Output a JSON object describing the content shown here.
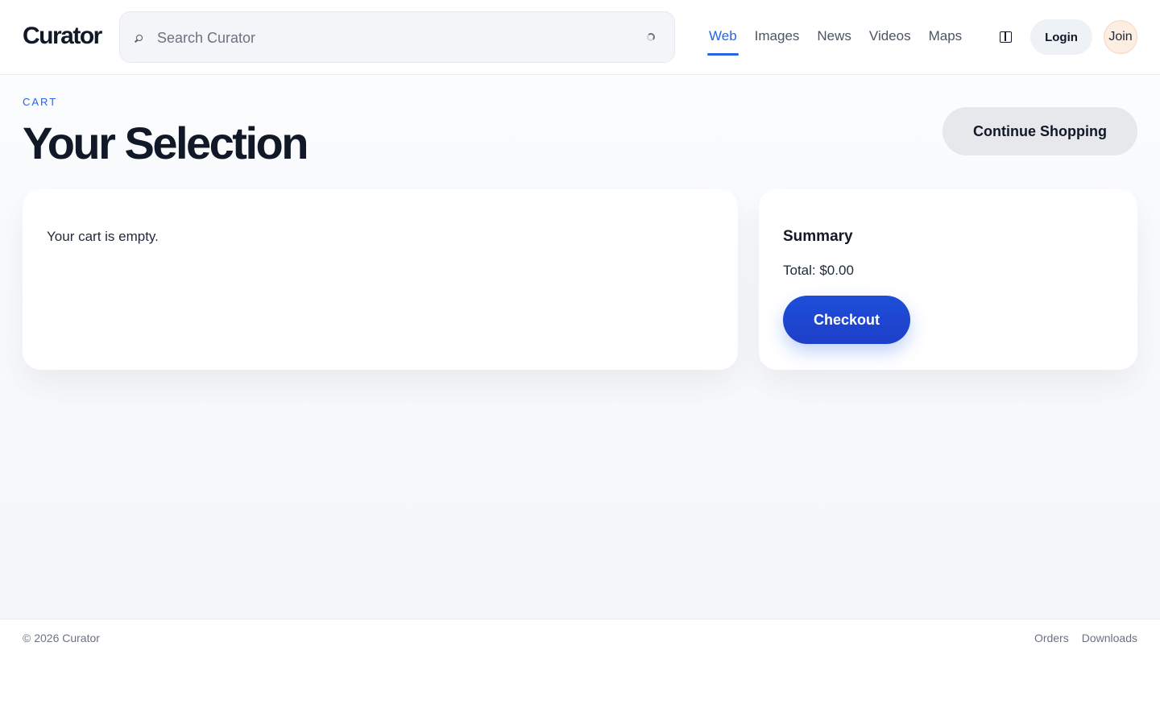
{
  "header": {
    "logo": "Curator",
    "search": {
      "placeholder": "Search Curator",
      "value": ""
    },
    "tabs": [
      {
        "label": "Web",
        "active": true
      },
      {
        "label": "Images"
      },
      {
        "label": "News"
      },
      {
        "label": "Videos"
      },
      {
        "label": "Maps"
      }
    ],
    "theme_icon": "split-panel-icon",
    "login_label": "Login",
    "join_label": "Join"
  },
  "main": {
    "eyebrow": "CART",
    "title": "Your Selection",
    "continue_label": "Continue Shopping",
    "cart": {
      "empty_message": "Your cart is empty."
    },
    "summary": {
      "title": "Summary",
      "total": "Total: $0.00",
      "checkout_label": "Checkout"
    }
  },
  "footer": {
    "copyright": "© 2026 Curator",
    "links": [
      "Orders",
      "Downloads"
    ]
  },
  "colors": {
    "accent": "#2563eb",
    "checkout": "#1d4ed8",
    "text": "#111827",
    "muted": "#6b7280"
  }
}
